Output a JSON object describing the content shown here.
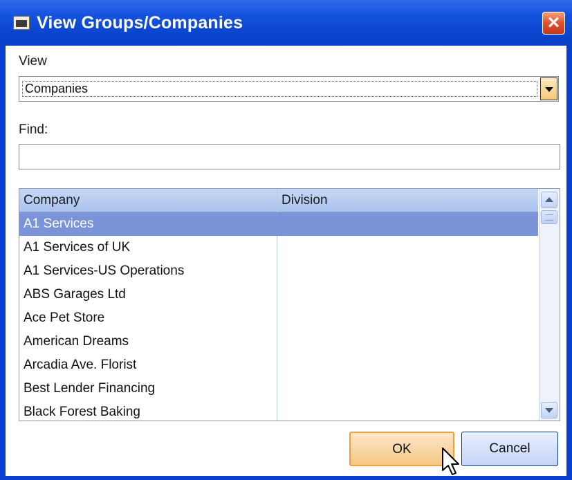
{
  "window": {
    "title": "View Groups/Companies",
    "close_glyph": "×"
  },
  "view": {
    "label": "View",
    "selected": "Companies"
  },
  "find": {
    "label": "Find:",
    "value": ""
  },
  "grid": {
    "columns": [
      "Company",
      "Division"
    ],
    "rows": [
      {
        "company": "A1 Services",
        "division": ""
      },
      {
        "company": "A1 Services of UK",
        "division": ""
      },
      {
        "company": "A1 Services-US Operations",
        "division": ""
      },
      {
        "company": "ABS Garages Ltd",
        "division": ""
      },
      {
        "company": "Ace Pet Store",
        "division": ""
      },
      {
        "company": "American Dreams",
        "division": ""
      },
      {
        "company": "Arcadia Ave. Florist",
        "division": ""
      },
      {
        "company": "Best Lender Financing",
        "division": ""
      },
      {
        "company": "Black Forest Baking",
        "division": ""
      }
    ],
    "selected_row": 0
  },
  "buttons": {
    "ok": "OK",
    "cancel": "Cancel"
  },
  "colors": {
    "titlebar": "#0a3fd0",
    "selection": "#7b93d8",
    "header": "#a9c3ee",
    "ok_button": "#f6c785"
  }
}
